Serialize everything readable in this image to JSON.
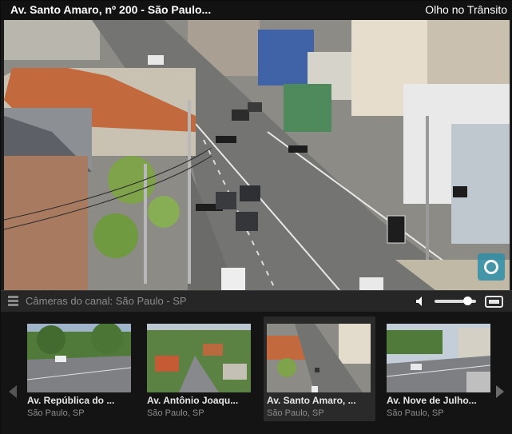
{
  "header": {
    "title": "Av. Santo Amaro, nº 200 - São Paulo...",
    "brand": "Olho no Trânsito"
  },
  "controls": {
    "menu_icon": "list-icon",
    "channel_label": "Câmeras do canal: São Paulo - SP",
    "volume_icon": "speaker-icon",
    "volume_level": 0.8,
    "fullscreen_icon": "fullscreen-icon"
  },
  "overlay": {
    "camera_icon": "camera-lens-icon"
  },
  "carousel": {
    "prev_icon": "chevron-left-icon",
    "next_icon": "chevron-right-icon",
    "cameras": [
      {
        "name": "Av. República do ...",
        "city": "São Paulo, SP",
        "active": false
      },
      {
        "name": "Av. Antônio Joaqu...",
        "city": "São Paulo, SP",
        "active": false
      },
      {
        "name": "Av. Santo Amaro, ...",
        "city": "São Paulo, SP",
        "active": true
      },
      {
        "name": "Av. Nove de Julho...",
        "city": "São Paulo, SP",
        "active": false
      }
    ]
  }
}
